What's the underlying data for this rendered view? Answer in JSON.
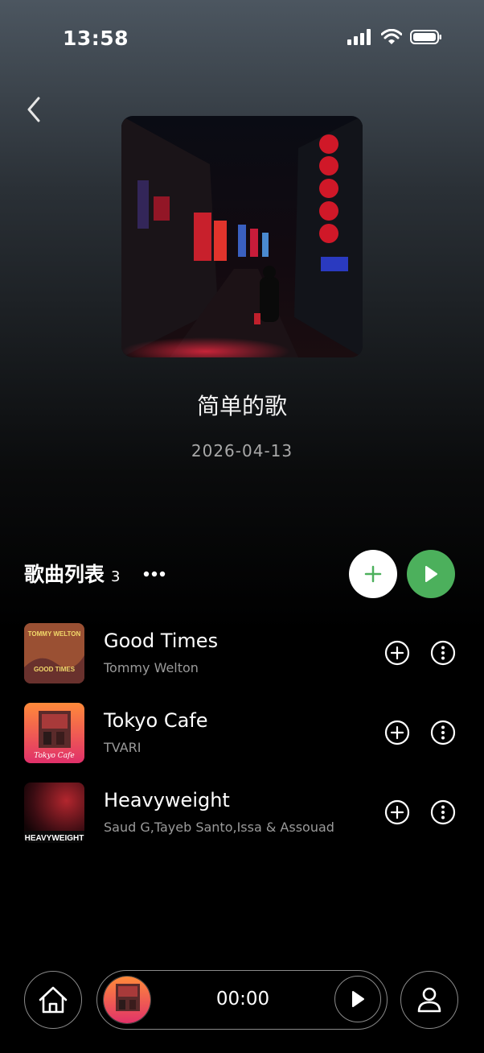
{
  "status_bar": {
    "time": "13:58"
  },
  "album": {
    "title": "简单的歌",
    "date": "2026-04-13",
    "cover_icon": "night-street-cover-image"
  },
  "song_list": {
    "title": "歌曲列表",
    "count": "3",
    "songs": [
      {
        "title": "Good Times",
        "artist": "Tommy Welton",
        "art_text_top": "TOMMY WELTON",
        "art_text_bottom": "GOOD TIMES"
      },
      {
        "title": "Tokyo Cafe",
        "artist": "TVARI",
        "art_text_bottom": "Tokyo Cafe"
      },
      {
        "title": "Heavyweight",
        "artist": "Saud G,Tayeb Santo,Issa & Assouad",
        "art_text_bottom": "HEAVYWEIGHT"
      }
    ]
  },
  "player": {
    "time": "00:00"
  },
  "colors": {
    "accent_green": "#4cb05c",
    "background": "#000000"
  }
}
